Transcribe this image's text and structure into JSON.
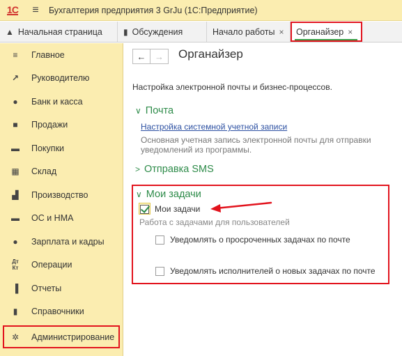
{
  "window": {
    "logo": "1С",
    "title": "Бухгалтерия предприятия 3 GrJu  (1С:Предприятие)"
  },
  "tabs": [
    {
      "label": "Начальная страница",
      "icon": "home-icon"
    },
    {
      "label": "Обсуждения",
      "icon": "chat-icon"
    },
    {
      "label": "Начало работы",
      "icon": "close-icon"
    },
    {
      "label": "Органайзер",
      "icon": "close-icon",
      "active": true
    }
  ],
  "sidebar": {
    "items": [
      {
        "label": "Главное",
        "icon": "menu-icon"
      },
      {
        "label": "Руководителю",
        "icon": "trend-icon"
      },
      {
        "label": "Банк и касса",
        "icon": "ruble-icon"
      },
      {
        "label": "Продажи",
        "icon": "bag-icon"
      },
      {
        "label": "Покупки",
        "icon": "cart-icon"
      },
      {
        "label": "Склад",
        "icon": "warehouse-icon"
      },
      {
        "label": "Производство",
        "icon": "factory-icon"
      },
      {
        "label": "ОС и НМА",
        "icon": "truck-icon"
      },
      {
        "label": "Зарплата и кадры",
        "icon": "person-icon"
      },
      {
        "label": "Операции",
        "icon": "dt-kt-icon"
      },
      {
        "label": "Отчеты",
        "icon": "bar-chart-icon"
      },
      {
        "label": "Справочники",
        "icon": "book-icon"
      },
      {
        "label": "Администрирование",
        "icon": "gear-icon",
        "highlighted": true
      }
    ]
  },
  "main": {
    "title": "Органайзер",
    "subtitle": "Настройка электронной почты и бизнес-процессов.",
    "sections": {
      "mail": {
        "title": "Почта",
        "link": "Настройка системной учетной записи",
        "description": "Основная учетная запись электронной почты для отправки уведомлений из программы."
      },
      "sms": {
        "title": "Отправка SMS"
      },
      "tasks": {
        "title": "Мои задачи",
        "checkbox_label": "Мои задачи",
        "checkbox_checked": true,
        "hint": "Работа с задачами для пользователей",
        "option1": "Уведомлять о просроченных задачах по почте",
        "option1_checked": false,
        "option2": "Уведомлять исполнителей о новых задачах по почте",
        "option2_checked": false
      }
    }
  },
  "colors": {
    "title_bar": "#fbedb0",
    "section_green": "#2d8b49",
    "highlight_red": "#e2131d",
    "link_blue": "#2b4fa1"
  }
}
